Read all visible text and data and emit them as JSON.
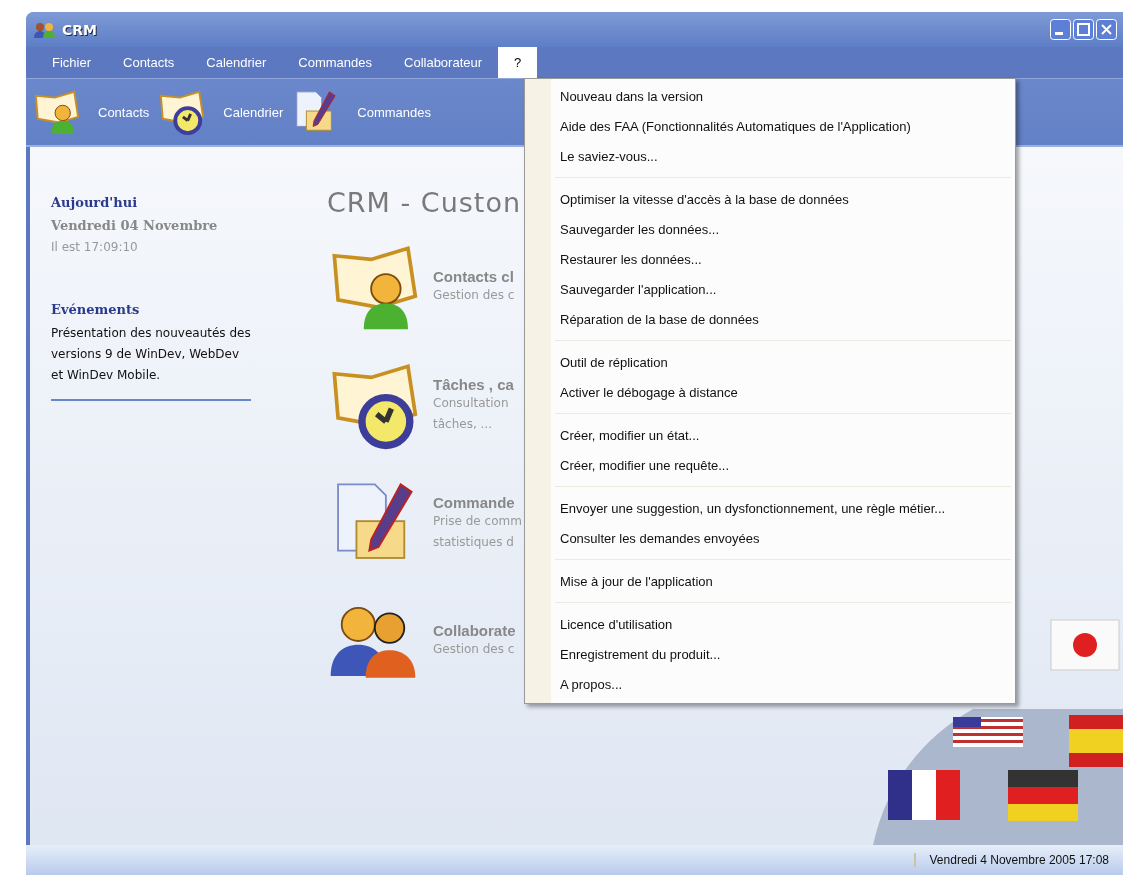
{
  "window": {
    "title": "CRM"
  },
  "menubar": [
    {
      "label": "Fichier",
      "selected": false
    },
    {
      "label": "Contacts",
      "selected": false
    },
    {
      "label": "Calendrier",
      "selected": false
    },
    {
      "label": "Commandes",
      "selected": false
    },
    {
      "label": "Collaborateur",
      "selected": false
    },
    {
      "label": "?",
      "selected": true
    }
  ],
  "toolbar": [
    {
      "kind": "contacts",
      "label": "Contacts"
    },
    {
      "kind": "calendar",
      "label": "Calendrier"
    },
    {
      "kind": "orders",
      "label": "Commandes"
    }
  ],
  "sidebar": {
    "today_heading": "Aujourd'hui",
    "date": "Vendredi 04 Novembre",
    "time": "Il est 17:09:10",
    "events_heading": "Evénements",
    "events_text": "Présentation des nouveautés des versions 9 de WinDev, WebDev et WinDev Mobile."
  },
  "main": {
    "title": "CRM - Custon",
    "modules": [
      {
        "kind": "contacts",
        "title": "Contacts cl",
        "description": [
          "Gestion des c"
        ]
      },
      {
        "kind": "calendar",
        "title": "Tâches , ca",
        "description": [
          "Consultation",
          "tâches, ..."
        ]
      },
      {
        "kind": "orders",
        "title": "Commande",
        "description": [
          "Prise de comm",
          "statistiques d"
        ]
      },
      {
        "kind": "team",
        "title": "Collaborate",
        "description": [
          "Gestion des c"
        ]
      }
    ]
  },
  "help_menu": {
    "groups": [
      [
        "Nouveau dans la version",
        "Aide des FAA (Fonctionnalités Automatiques de l'Application)",
        "Le saviez-vous..."
      ],
      [
        "Optimiser la vitesse d'accès à la base de données",
        "Sauvegarder les données...",
        "Restaurer les données...",
        "Sauvegarder l'application...",
        "Réparation de la base de données"
      ],
      [
        "Outil de réplication",
        "Activer le débogage à distance"
      ],
      [
        "Créer, modifier un état...",
        "Créer, modifier une requête..."
      ],
      [
        "Envoyer une suggestion, un dysfonctionnement, une règle métier...",
        "Consulter les demandes envoyées"
      ],
      [
        "Mise à jour de l'application"
      ],
      [
        "Licence d'utilisation",
        "Enregistrement du produit...",
        "A propos..."
      ]
    ]
  },
  "status_bar": {
    "date_time": "Vendredi 4 Novembre 2005 17:08"
  }
}
